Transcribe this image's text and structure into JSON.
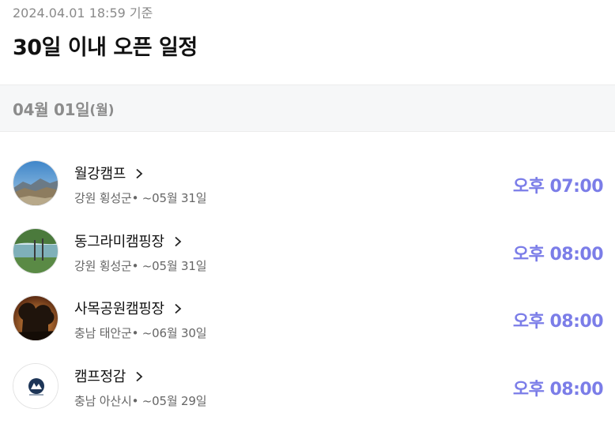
{
  "header": {
    "timestamp": "2024.04.01 18:59 기준",
    "title": "30일 이내 오픈 일정"
  },
  "date_section": {
    "date": "04월 01일",
    "weekday": "(월)"
  },
  "items": [
    {
      "name": "월강캠프",
      "location": "강원 횡성군",
      "until": "~05월 31일",
      "time": "오후 07:00",
      "thumbnail": "mountain-photo"
    },
    {
      "name": "동그라미캠핑장",
      "location": "강원 횡성군",
      "until": "~05월 31일",
      "time": "오후 08:00",
      "thumbnail": "lake-photo"
    },
    {
      "name": "사목공원캠핑장",
      "location": "충남 태안군",
      "until": "~06월 30일",
      "time": "오후 08:00",
      "thumbnail": "sunset-photo"
    },
    {
      "name": "캠프정감",
      "location": "충남 아산시",
      "until": "~05월 29일",
      "time": "오후 08:00",
      "thumbnail": "logo-image"
    }
  ],
  "colors": {
    "time_accent": "#7b7de8",
    "date_bar_bg": "#f6f7f8"
  }
}
